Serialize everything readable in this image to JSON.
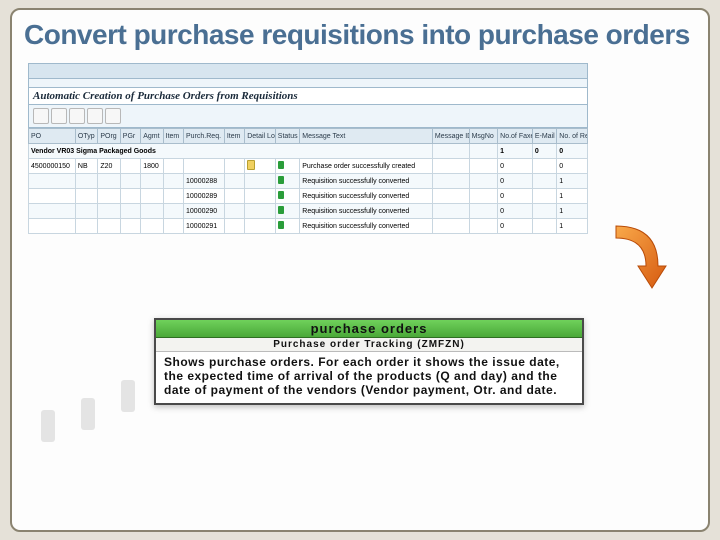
{
  "title": "Convert purchase requisitions into purchase orders",
  "sap": {
    "window_title": "Automatic Creation of Purchase Orders from Requisitions",
    "columns": [
      "PO",
      "OTyp",
      "POrg",
      "PGr",
      "Agmt",
      "Item",
      "Purch.Req.",
      "Item",
      "Detail Log",
      "Status",
      "Message Text",
      "Message ID",
      "MsgNo",
      "No.of Faxes",
      "E-Mail",
      "No. of Requ."
    ],
    "vendor_row": "Vendor VR03 Sigma Packaged Goods",
    "rows": [
      {
        "po": "4500000150",
        "otyp": "NB",
        "porg": "Z20",
        "pgr": "",
        "agmt": "1800",
        "item_a": "",
        "req": "",
        "item_b": "",
        "detail": "y",
        "status": "g",
        "msg": "Purchase order successfully created",
        "faxes": "0",
        "email": "",
        "nreq": "0"
      },
      {
        "po": "",
        "otyp": "",
        "porg": "",
        "pgr": "",
        "agmt": "",
        "item_a": "",
        "req": "10000288",
        "item_b": "",
        "detail": "",
        "status": "g",
        "msg": "Requisition successfully converted",
        "faxes": "0",
        "email": "",
        "nreq": "1"
      },
      {
        "po": "",
        "otyp": "",
        "porg": "",
        "pgr": "",
        "agmt": "",
        "item_a": "",
        "req": "10000289",
        "item_b": "",
        "detail": "",
        "status": "g",
        "msg": "Requisition successfully converted",
        "faxes": "0",
        "email": "",
        "nreq": "1"
      },
      {
        "po": "",
        "otyp": "",
        "porg": "",
        "pgr": "",
        "agmt": "",
        "item_a": "",
        "req": "10000290",
        "item_b": "",
        "detail": "",
        "status": "g",
        "msg": "Requisition successfully converted",
        "faxes": "0",
        "email": "",
        "nreq": "1"
      },
      {
        "po": "",
        "otyp": "",
        "porg": "",
        "pgr": "",
        "agmt": "",
        "item_a": "",
        "req": "10000291",
        "item_b": "",
        "detail": "",
        "status": "g",
        "msg": "Requisition successfully converted",
        "faxes": "0",
        "email": "",
        "nreq": "1"
      }
    ]
  },
  "callout": {
    "head1": "purchase orders",
    "head2": "Purchase order Tracking (ZMFZN)",
    "body": "Shows purchase orders. For each order it shows the issue date, the expected time of arrival of the products (Q and day) and the date of payment of the vendors (Vendor payment, Otr. and date."
  }
}
